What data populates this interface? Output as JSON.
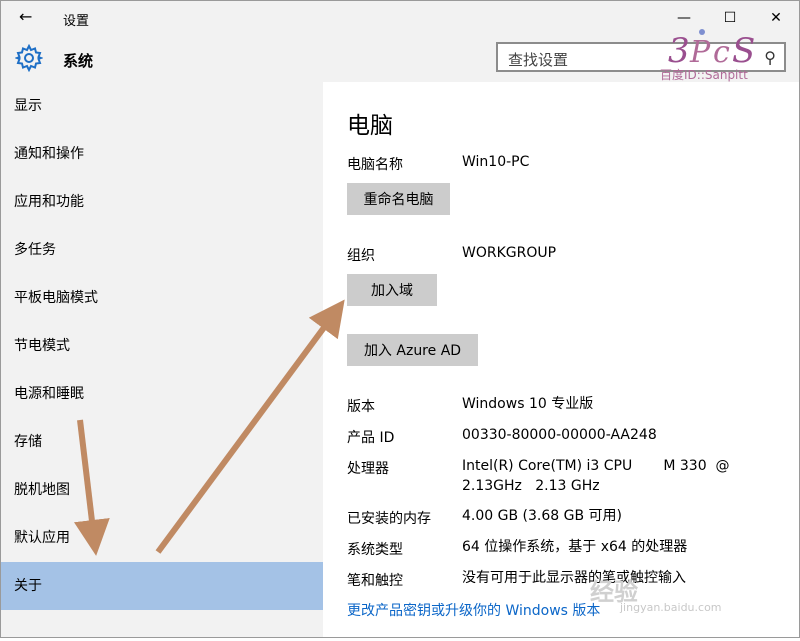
{
  "window": {
    "back_icon": "←",
    "title": "设置",
    "minimize_icon": "—",
    "maximize_icon": "☐",
    "close_icon": "✕"
  },
  "header": {
    "icon": "gear-icon",
    "title": "系统",
    "search_placeholder": "查找设置",
    "search_icon": "⚲"
  },
  "sidebar": {
    "items": [
      {
        "label": "显示"
      },
      {
        "label": "通知和操作"
      },
      {
        "label": "应用和功能"
      },
      {
        "label": "多任务"
      },
      {
        "label": "平板电脑模式"
      },
      {
        "label": "节电模式"
      },
      {
        "label": "电源和睡眠"
      },
      {
        "label": "存储"
      },
      {
        "label": "脱机地图"
      },
      {
        "label": "默认应用"
      },
      {
        "label": "关于"
      }
    ],
    "selected_index": 10
  },
  "content": {
    "title": "电脑",
    "pc_name_label": "电脑名称",
    "pc_name_value": "Win10-PC",
    "rename_button": "重命名电脑",
    "org_label": "组织",
    "org_value": "WORKGROUP",
    "join_domain_button": "加入域",
    "join_azure_button": "加入 Azure AD",
    "edition_label": "版本",
    "edition_value": "Windows 10 专业版",
    "product_id_label": "产品 ID",
    "product_id_value": "00330-80000-00000-AA248",
    "processor_label": "处理器",
    "processor_value_line1": "Intel(R) Core(TM) i3 CPU       M 330  @",
    "processor_value_line2": "2.13GHz   2.13 GHz",
    "ram_label": "已安装的内存",
    "ram_value": "4.00 GB (3.68 GB 可用)",
    "system_type_label": "系统类型",
    "system_type_value": "64 位操作系统，基于 x64 的处理器",
    "pen_label": "笔和触控",
    "pen_value": "没有可用于此显示器的笔或触控输入",
    "change_key_link": "更改产品密钥或升级你的 Windows 版本"
  },
  "watermarks": {
    "top_text": "百度ID::Sanpitt",
    "bottom_text": "经验",
    "bottom_url": "jingyan.baidu.com"
  },
  "colors": {
    "sidebar_bg": "#f2f2f2",
    "selected_bg": "#a4c2e6",
    "button_bg": "#cccccc",
    "link": "#0b66c8",
    "arrow": "#c08a63"
  }
}
